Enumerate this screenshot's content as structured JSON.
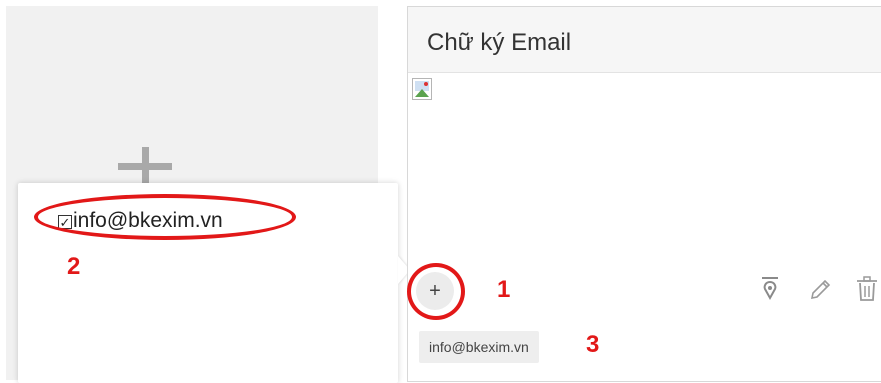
{
  "add_tile": {
    "icon": "plus-icon"
  },
  "popup": {
    "options": [
      {
        "label": "info@bkexim.vn",
        "checked": true
      }
    ]
  },
  "card": {
    "title": "Chữ ký Email",
    "image_icon": "broken-image-icon",
    "add_button_label": "+",
    "tools": [
      "pin-icon",
      "pencil-icon",
      "trash-icon"
    ],
    "tag": "info@bkexim.vn"
  },
  "annotations": {
    "marker_1": "1",
    "marker_2": "2",
    "marker_3": "3",
    "color": "#e21818"
  }
}
